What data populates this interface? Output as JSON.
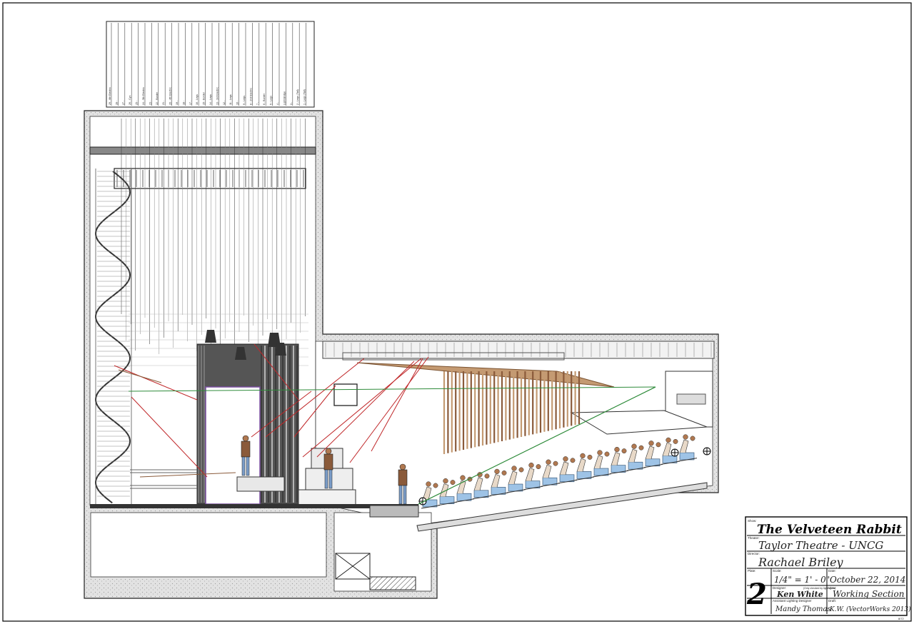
{
  "title_block": {
    "show_label": "Show:",
    "show": "The Velveteen Rabbit",
    "theater_label": "Theater:",
    "theater": "Taylor Theatre - UNCG",
    "director_label": "Director:",
    "director": "Rachael Briley",
    "plate_label": "Plate:",
    "plate": "2",
    "scale_label": "Scale:",
    "scale": "1/4\" = 1' - 0\"",
    "date_label": "Date:",
    "date": "October 22, 2014",
    "designer_label": "Designer:",
    "designer": "Ken White",
    "designer_note": "(Only checked by lighting dir)",
    "view_label": "View:",
    "view": "Working Section",
    "assistant_label": "Assistant Lighting Designer",
    "assistant": "Mandy Thomas",
    "draft_label": "Draft:",
    "draft": "K.W. (VectorWorks 2013)",
    "page_mark": "8/72"
  },
  "lineset_labels": [
    "29 - 6th Electric",
    "28 -",
    "27 -",
    "26 - Cyc",
    "25 -",
    "24 - 5th Electric",
    "23 -",
    "22 - Border",
    "21 -",
    "20 - 4th Electric",
    "19 -",
    "18 -",
    "17 -",
    "16 - Legs",
    "15 - Border",
    "14 - Legs",
    "13 - 3rd Electric",
    "12 -",
    "11 - Legs",
    "10 -",
    "9 - Legs",
    "8 - 2nd Electric",
    "7 -",
    "6 - Border",
    "5 - Legs",
    "4 -",
    "Light Bridge",
    "3 -",
    "2 - Legs (Tall)",
    "1 - Legs (Tall)"
  ],
  "colors": {
    "ink": "#1a1a1a",
    "beam_red": "#c0282a",
    "beam_green": "#2e8b3a",
    "seat_blue": "#9ec3e6",
    "wood": "#8a5a3a",
    "title_green": "#1f7a2a",
    "concrete": "#d9d9d9"
  },
  "icons": {
    "figures": "person-icon",
    "lights": "spotlight-icon"
  }
}
